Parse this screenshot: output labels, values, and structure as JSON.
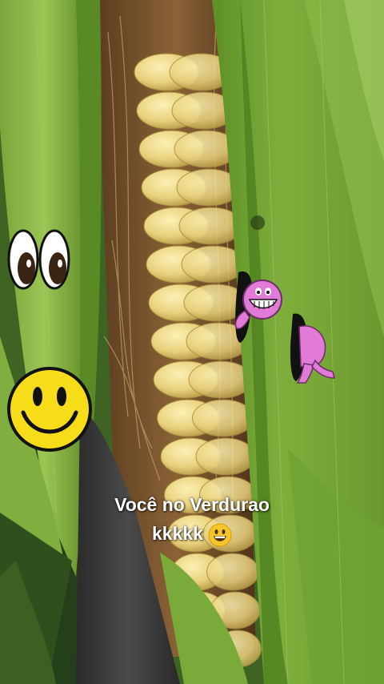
{
  "caption": {
    "line1": "Você no Verdurao",
    "line2": "kkkkk"
  },
  "stickers": {
    "eyes": "googly-eyes-sticker",
    "smiley": "yellow-smiley-sticker",
    "purple_character": "purple-grinning-character-sticker",
    "purple_legs": "purple-character-legs-sticker",
    "caption_emoji": "grinning-face-emoji"
  },
  "colors": {
    "leaf_green": "#6f9c2f",
    "corn_yellow": "#e8d27e",
    "smiley_yellow": "#f7dc1a",
    "purple": "#e27ad8",
    "caption_text": "#ffffff"
  }
}
